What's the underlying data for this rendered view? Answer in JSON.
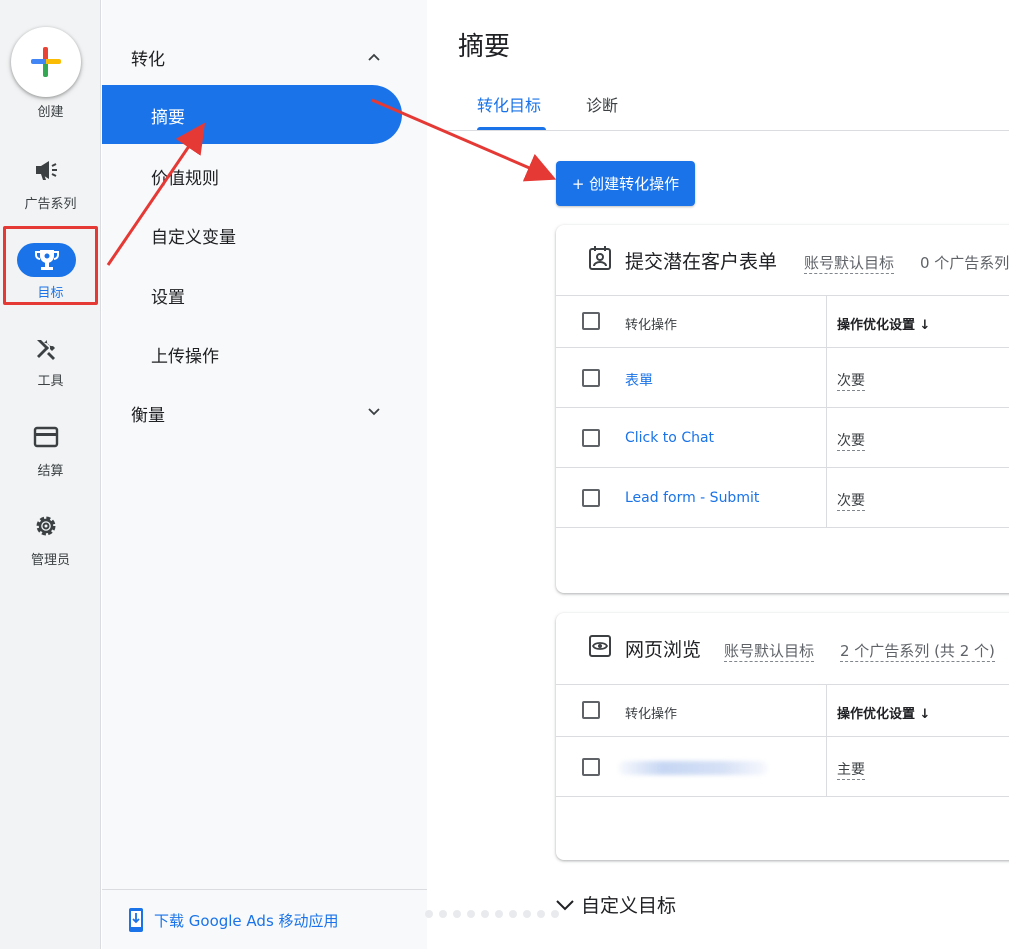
{
  "rail": {
    "create_label": "创建",
    "items": [
      {
        "label": "广告系列",
        "icon": "megaphone-icon"
      },
      {
        "label": "目标",
        "icon": "trophy-icon"
      },
      {
        "label": "工具",
        "icon": "tools-icon"
      },
      {
        "label": "结算",
        "icon": "credit-card-icon"
      },
      {
        "label": "管理员",
        "icon": "gear-icon"
      }
    ]
  },
  "subnav": {
    "group1": "转化",
    "items": [
      "摘要",
      "价值规则",
      "自定义变量",
      "设置",
      "上传操作"
    ],
    "group2": "衡量",
    "download": "下载 Google Ads 移动应用"
  },
  "main": {
    "title": "摘要",
    "tabs": [
      "转化目标",
      "诊断"
    ],
    "create_button": "+ 创建转化操作",
    "cards": [
      {
        "icon": "contact-form-icon",
        "title": "提交潜在客户表单",
        "badge": "账号默认目标",
        "meta": "0 个广告系列",
        "col1": "转化操作",
        "col2": "操作优化设置",
        "rows": [
          {
            "name": "表單",
            "setting": "次要"
          },
          {
            "name": "Click to Chat",
            "setting": "次要"
          },
          {
            "name": "Lead form - Submit",
            "setting": "次要"
          }
        ]
      },
      {
        "icon": "eye-icon",
        "title": "网页浏览",
        "badge": "账号默认目标",
        "meta": "2 个广告系列 (共 2 个)",
        "col1": "转化操作",
        "col2": "操作优化设置",
        "rows": [
          {
            "name": "",
            "setting": "主要"
          }
        ]
      }
    ],
    "custom_goals": "自定义目标"
  },
  "colors": {
    "accent": "#1a73e8",
    "annotation": "#e53935"
  }
}
